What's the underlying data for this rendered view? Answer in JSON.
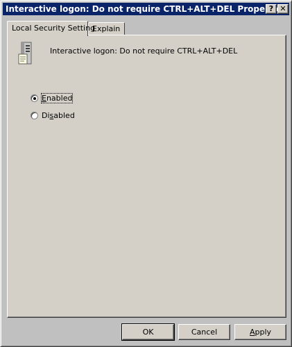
{
  "window": {
    "title": "Interactive logon: Do not require CTRL+ALT+DEL Properties",
    "help_button": "?",
    "close_button": "✕"
  },
  "tabs": [
    {
      "label": "Local Security Setting",
      "active": true
    },
    {
      "label": "Explain",
      "active": false
    }
  ],
  "policy": {
    "icon": "server-policy-icon",
    "name": "Interactive logon: Do not require CTRL+ALT+DEL"
  },
  "options": {
    "enabled": {
      "label_access": "E",
      "label_rest": "nabled",
      "checked": true
    },
    "disabled": {
      "label_pre": "Di",
      "label_access": "s",
      "label_rest": "abled",
      "checked": false
    }
  },
  "buttons": {
    "ok": "OK",
    "cancel": "Cancel",
    "apply_access": "A",
    "apply_rest": "pply"
  },
  "colors": {
    "title_bar": "#0a246a",
    "face": "#d4d0c8"
  }
}
